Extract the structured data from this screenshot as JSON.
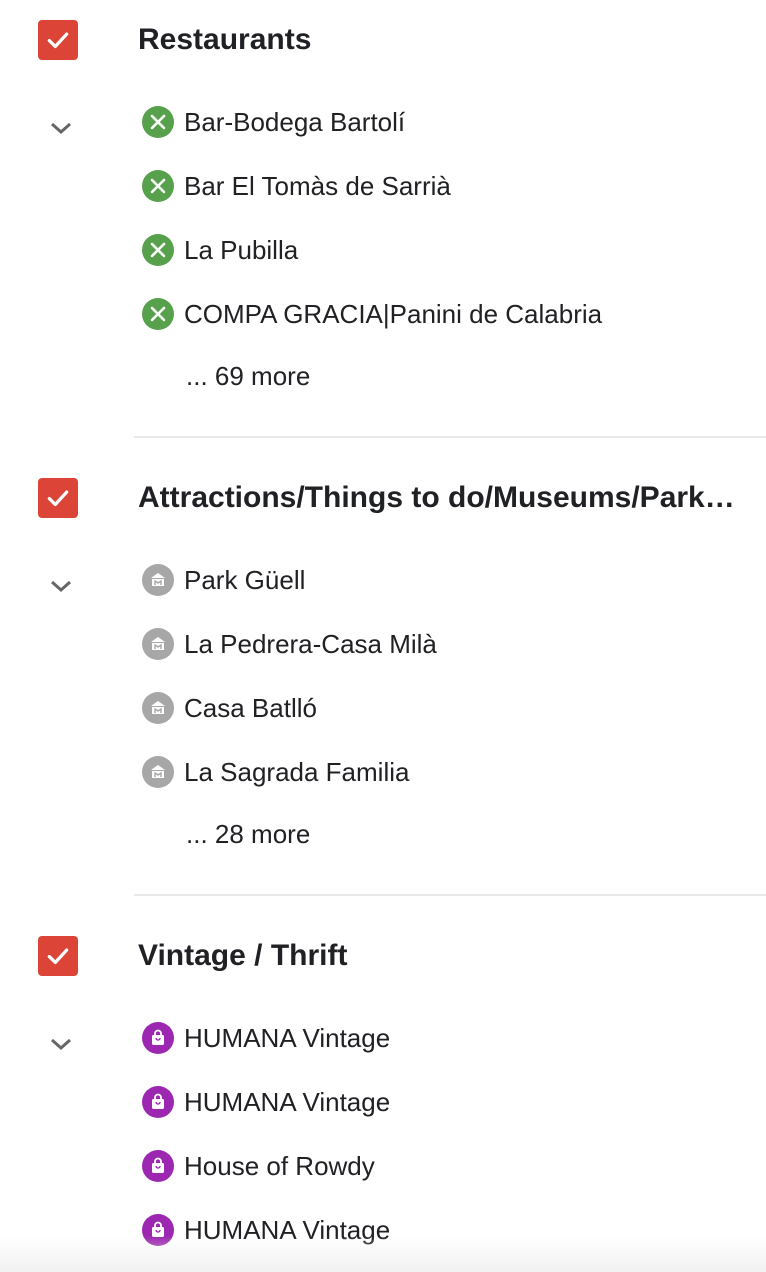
{
  "groups": [
    {
      "title": "Restaurants",
      "icon": "restaurant-icon",
      "icon_color": "#57a14d",
      "places": [
        "Bar-Bodega Bartolí",
        "Bar El Tomàs de Sarrià",
        "La Pubilla",
        "COMPA GRACIA|Panini de Calabria"
      ],
      "more": "... 69 more"
    },
    {
      "title": "Attractions/Things to do/Museums/Parks/Galleries",
      "icon": "museum-icon",
      "icon_color": "#a7a7a7",
      "places": [
        "Park Güell",
        "La Pedrera-Casa Milà",
        "Casa Batlló",
        "La Sagrada Familia"
      ],
      "more": "... 28 more"
    },
    {
      "title": "Vintage / Thrift",
      "icon": "shopping-bag-icon",
      "icon_color": "#9c27b0",
      "places": [
        "HUMANA Vintage",
        "HUMANA Vintage",
        "House of Rowdy",
        "HUMANA Vintage"
      ],
      "more": ""
    }
  ],
  "colors": {
    "checkbox": "#db4437",
    "chevron": "#666666",
    "divider": "#e8e8e8"
  }
}
